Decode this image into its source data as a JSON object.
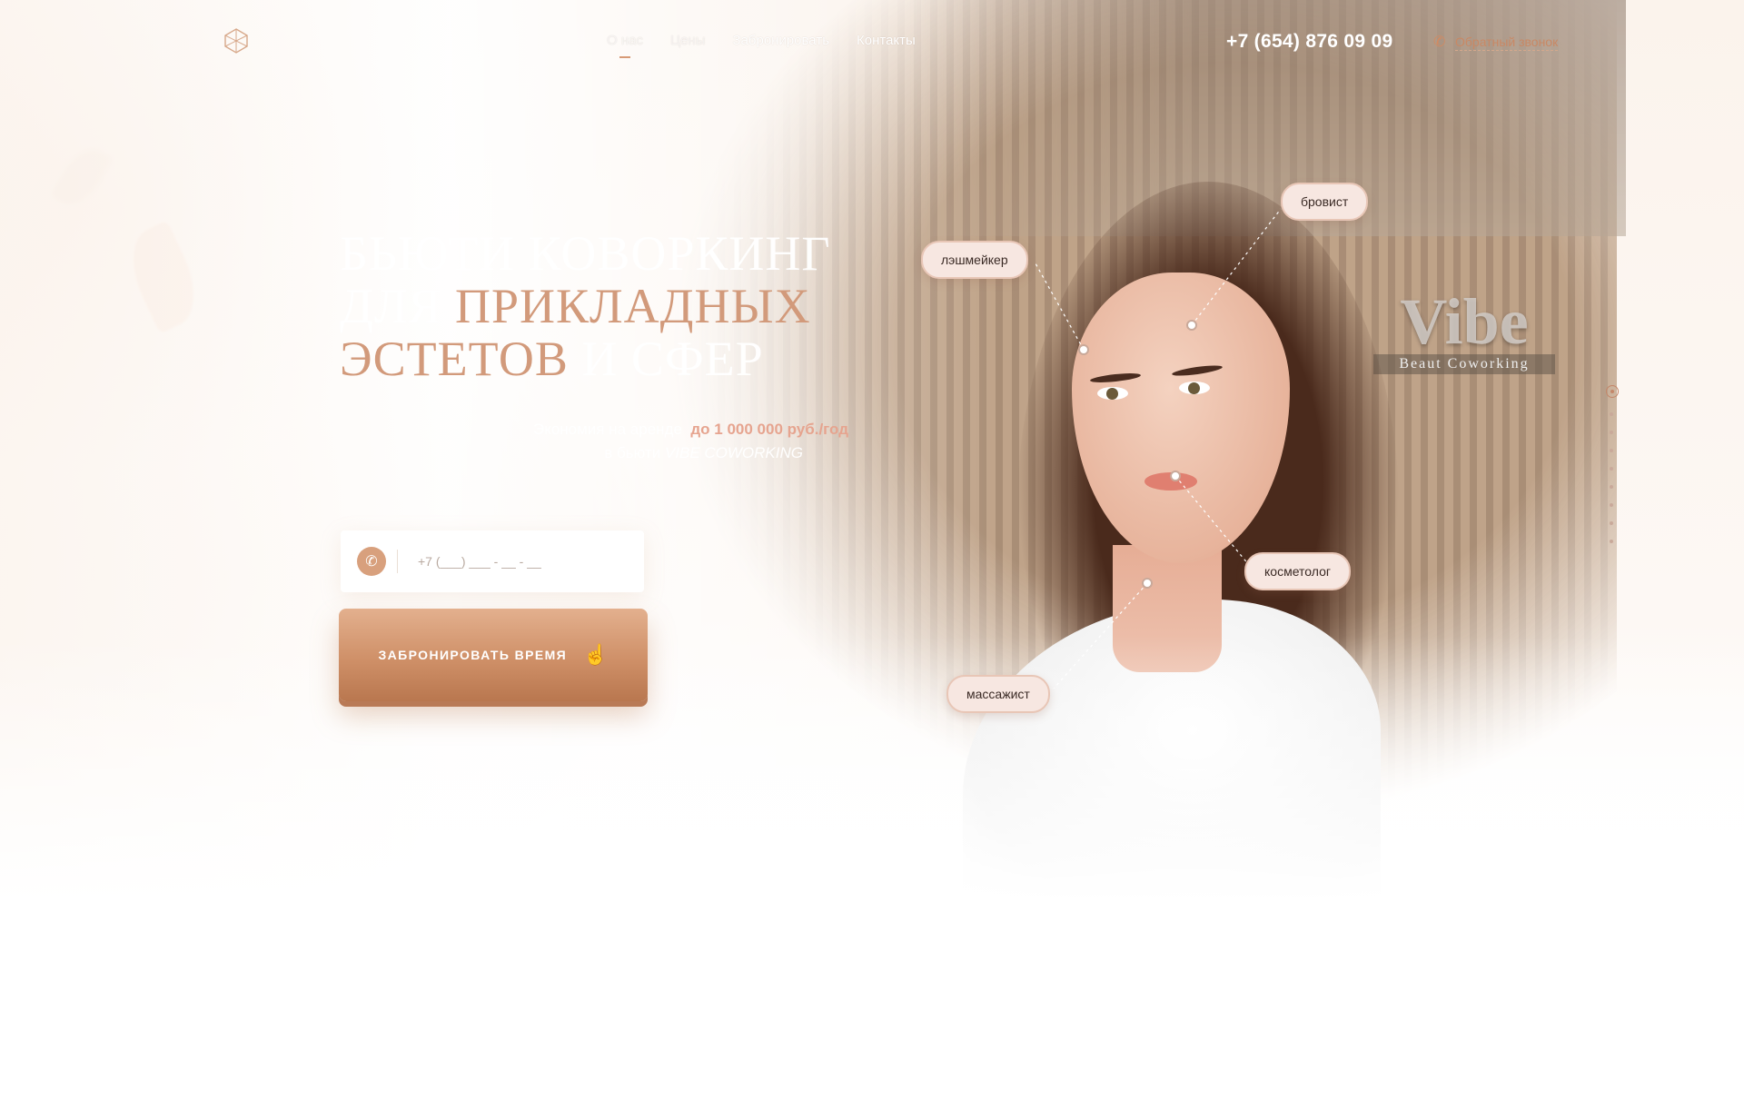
{
  "header": {
    "nav": [
      {
        "label": "О нас",
        "active": true
      },
      {
        "label": "Цены",
        "active": false
      },
      {
        "label": "Забронировать",
        "active": false
      },
      {
        "label": "Контакты",
        "active": false
      }
    ],
    "phone": "+7 (654) 876 09 09",
    "callback_label": "Обратный звонок"
  },
  "hero": {
    "title_line1": "БЬЮТИ КОВОРКИНГ",
    "title_line2_a": "ДЛЯ ",
    "title_line2_b": "ПРИКЛАДНЫХ",
    "title_line3_a": "ЭСТЕТОВ",
    "title_line3_b": " И СФЕР",
    "subtitle_prefix": "Экономия на аренде",
    "subtitle_accent": "до 1 000 000 руб./год",
    "subtitle_line2_prefix": "в бьюти ",
    "subtitle_line2_italic": "VIBE COWORKING",
    "phone_placeholder": "+7 (___) ___ - __ - __",
    "cta_label": "ЗАБРОНИРОВАТЬ ВРЕМЯ"
  },
  "tags": {
    "browist": "бровист",
    "lashmaker": "лэшмейкер",
    "cosmetologist": "косметолог",
    "masseur": "массажист"
  },
  "sign": {
    "big": "Vibe",
    "small": "Beaut  Coworking"
  },
  "colors": {
    "accent": "#d29a7b",
    "button": "#cf9068",
    "tag_bg": "#f7e7e1"
  },
  "icons": {
    "logo": "hexagon-logo-icon",
    "callback": "phone-icon",
    "input": "phone-icon",
    "cta": "pointing-hand-icon"
  },
  "sidenav": {
    "total": 10,
    "active_index": 0
  }
}
